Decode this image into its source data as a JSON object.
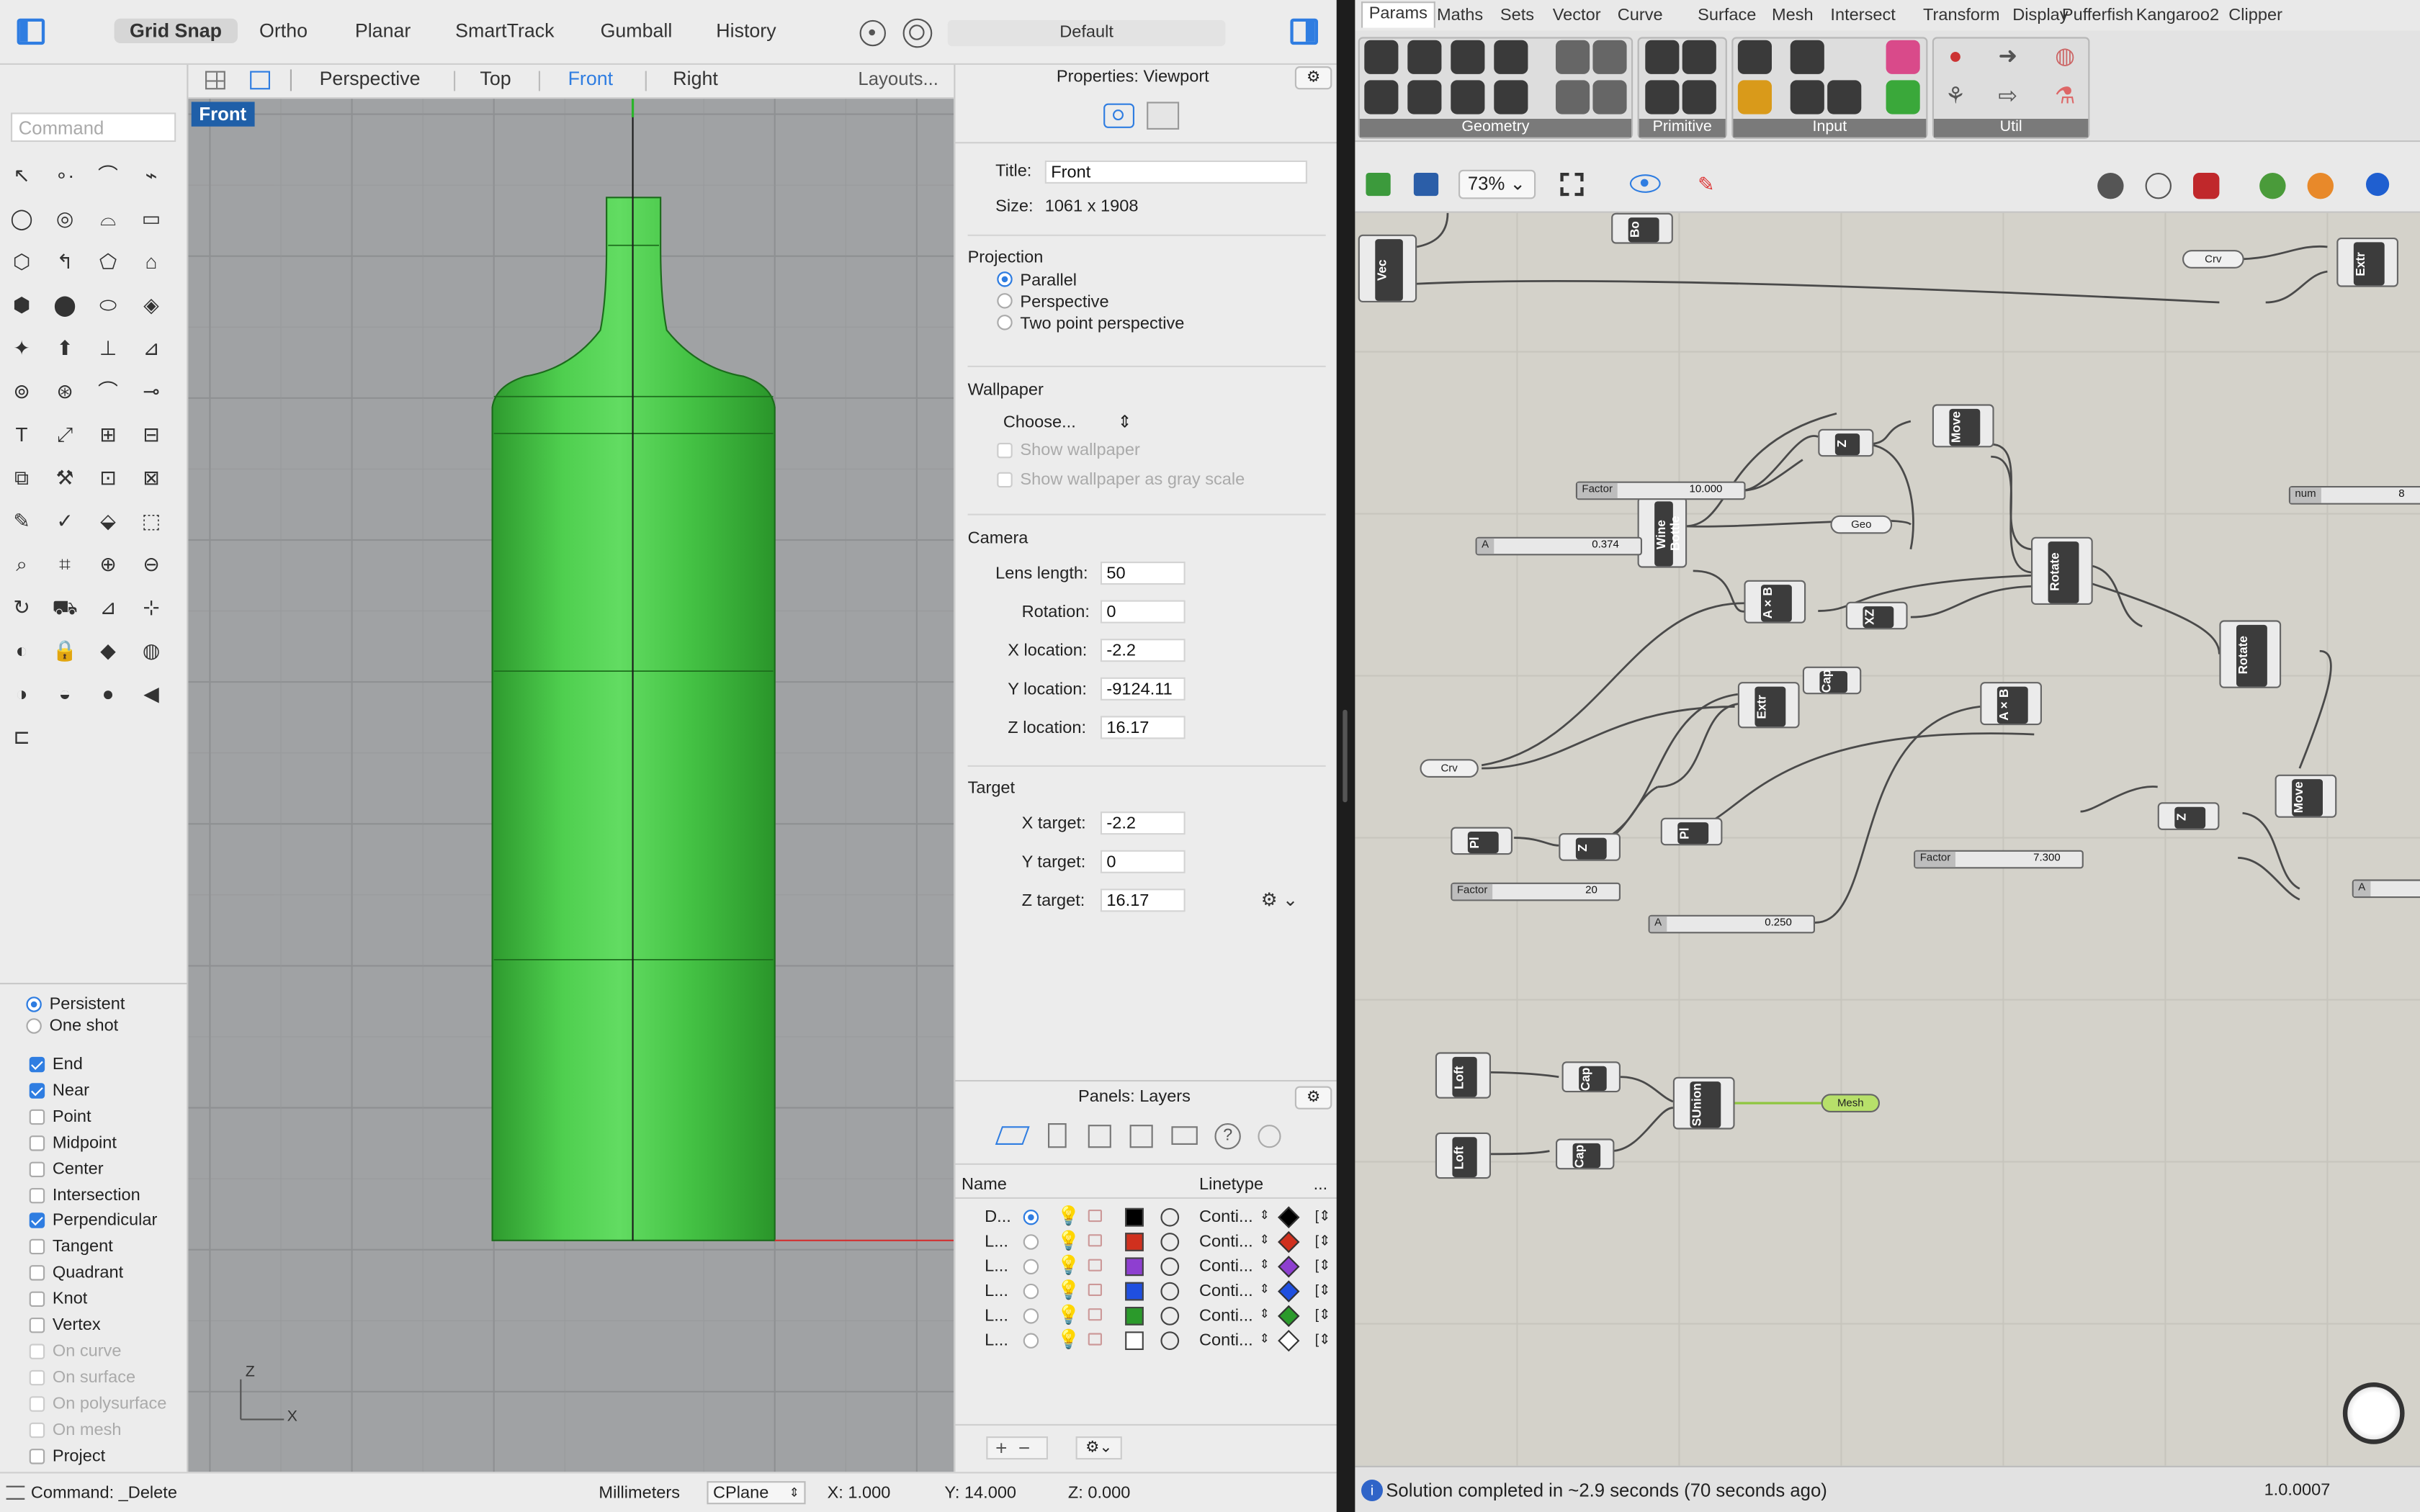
{
  "toolbar": {
    "grid_snap": "Grid Snap",
    "ortho": "Ortho",
    "planar": "Planar",
    "smarttrack": "SmartTrack",
    "gumball": "Gumball",
    "history": "History",
    "layer": "Default"
  },
  "view_tabs": {
    "perspective": "Perspective",
    "top": "Top",
    "front": "Front",
    "right": "Right",
    "layouts": "Layouts..."
  },
  "command": {
    "placeholder": "Command"
  },
  "viewport": {
    "label": "Front",
    "axis_z": "Z",
    "axis_x": "X",
    "object_color": "#3fbf3f",
    "bg_color": "#a0a2a4"
  },
  "osnap": {
    "persistent": "Persistent",
    "one_shot": "One shot",
    "items": [
      {
        "label": "End",
        "checked": true
      },
      {
        "label": "Near",
        "checked": true
      },
      {
        "label": "Point",
        "checked": false
      },
      {
        "label": "Midpoint",
        "checked": false
      },
      {
        "label": "Center",
        "checked": false
      },
      {
        "label": "Intersection",
        "checked": false
      },
      {
        "label": "Perpendicular",
        "checked": true
      },
      {
        "label": "Tangent",
        "checked": false
      },
      {
        "label": "Quadrant",
        "checked": false
      },
      {
        "label": "Knot",
        "checked": false
      },
      {
        "label": "Vertex",
        "checked": false
      },
      {
        "label": "On curve",
        "checked": false,
        "disabled": true
      },
      {
        "label": "On surface",
        "checked": false,
        "disabled": true
      },
      {
        "label": "On polysurface",
        "checked": false,
        "disabled": true
      },
      {
        "label": "On mesh",
        "checked": false,
        "disabled": true
      },
      {
        "label": "Project",
        "checked": false
      }
    ]
  },
  "properties": {
    "header": "Properties: Viewport",
    "title_label": "Title:",
    "title_value": "Front",
    "size_label": "Size:",
    "size_value": "1061 x 1908",
    "projection_head": "Projection",
    "parallel": "Parallel",
    "perspective": "Perspective",
    "two_point": "Two point perspective",
    "wallpaper_head": "Wallpaper",
    "choose": "Choose...",
    "show_wallpaper": "Show wallpaper",
    "show_gray": "Show wallpaper as gray scale",
    "camera_head": "Camera",
    "lens_label": "Lens length:",
    "lens": "50",
    "rotation_label": "Rotation:",
    "rotation": "0",
    "xloc_label": "X location:",
    "xloc": "-2.2",
    "yloc_label": "Y location:",
    "yloc": "-9124.11",
    "zloc_label": "Z location:",
    "zloc": "16.17",
    "target_head": "Target",
    "xt_label": "X target:",
    "xt": "-2.2",
    "yt_label": "Y target:",
    "yt": "0",
    "zt_label": "Z target:",
    "zt": "16.17"
  },
  "layers": {
    "header": "Panels: Layers",
    "col_name": "Name",
    "col_linetype": "Linetype",
    "col_more": "...",
    "rows": [
      {
        "name": "D...",
        "color": "#000000",
        "linetype": "Conti...",
        "current": true
      },
      {
        "name": "L...",
        "color": "#d0301e",
        "linetype": "Conti..."
      },
      {
        "name": "L...",
        "color": "#8e3fd0",
        "linetype": "Conti..."
      },
      {
        "name": "L...",
        "color": "#1f4fe0",
        "linetype": "Conti..."
      },
      {
        "name": "L...",
        "color": "#2b9a2b",
        "linetype": "Conti..."
      },
      {
        "name": "L...",
        "color": "#ffffff",
        "linetype": "Conti..."
      }
    ]
  },
  "statusbar": {
    "command": "Command: _Delete",
    "units": "Millimeters",
    "cplane": "CPlane",
    "x": "X: 1.000",
    "y": "Y: 14.000",
    "z": "Z: 0.000"
  },
  "gh": {
    "tabs": [
      "Params",
      "Maths",
      "Sets",
      "Vector",
      "Curve",
      "Surface",
      "Mesh",
      "Intersect",
      "Transform",
      "Display",
      "Pufferfish",
      "Kangaroo2",
      "Clipper"
    ],
    "groups": {
      "geometry": "Geometry",
      "primitive": "Primitive",
      "input": "Input",
      "util": "Util"
    },
    "zoom": "73%",
    "status": "Solution completed in ~2.9 seconds (70 seconds ago)",
    "version": "1.0.0007",
    "nodes": {
      "vec": "Vec",
      "bo": "Bo",
      "extr": "Extr",
      "wine": "Wine Bottle",
      "move": "Move",
      "rotate": "Rotate",
      "axb": "A×B",
      "xz": "XZ",
      "cap": "Cap",
      "pl": "Pl",
      "z": "Z",
      "loft": "Loft",
      "sunion": "SUnion"
    },
    "pills": {
      "crv": "Crv",
      "geo": "Geo",
      "mesh": "Mesh"
    },
    "sliders": {
      "factor": "Factor",
      "a": "A",
      "num": "num",
      "v10": "10.000",
      "v0374": "0.374",
      "v20": "20",
      "v0250": "0.250",
      "v7300": "7.300",
      "v8": "8"
    }
  }
}
